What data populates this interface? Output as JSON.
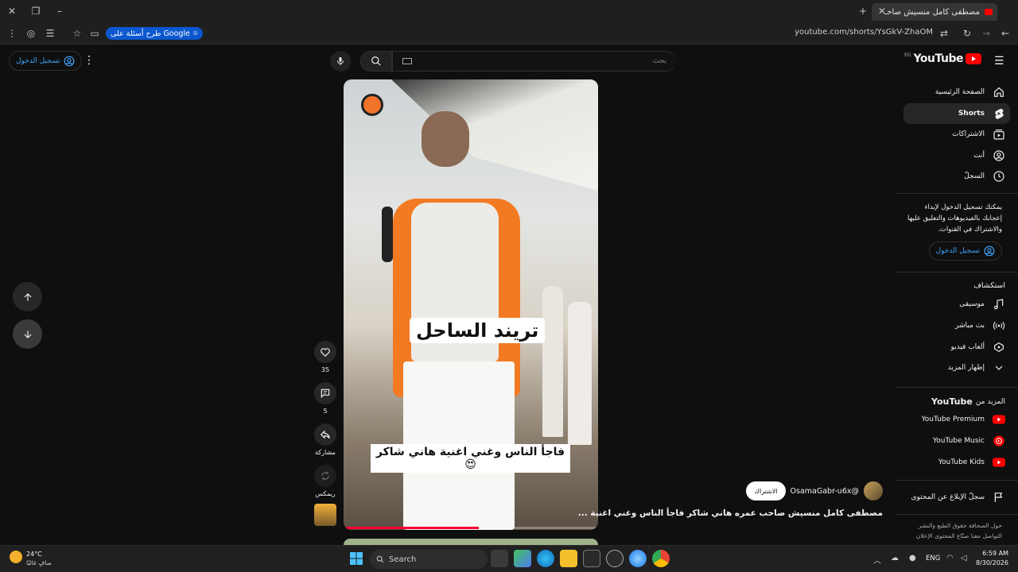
{
  "browser": {
    "tab_title": "مصطفى كامل منسيش صاحـ",
    "url": "youtube.com/shorts/YsGkV-ZhaOM",
    "google_pill": "طرح أسئلة على Google"
  },
  "youtube": {
    "logo_text": "YouTube",
    "logo_region": "EG",
    "search_placeholder": "بحث",
    "signin_label": "تسجيل الدخول"
  },
  "sidebar": {
    "items": [
      {
        "label": "الصفحة الرئيسية",
        "icon": "home-icon"
      },
      {
        "label": "Shorts",
        "icon": "shorts-icon",
        "active": true
      },
      {
        "label": "الاشتراكات",
        "icon": "subscriptions-icon"
      },
      {
        "label": "أنت",
        "icon": "you-icon"
      },
      {
        "label": "السجلّ",
        "icon": "history-icon"
      }
    ],
    "signin_prompt": "يمكنك تسجيل الدخول لإبداء إعجابك بالفيديوهات والتعليق عليها والاشتراك في القنوات.",
    "signin_label": "تسجيل الدخول",
    "explore_heading": "استكشاف",
    "explore_items": [
      {
        "label": "موسيقى",
        "icon": "music-icon"
      },
      {
        "label": "بث مباشر",
        "icon": "live-icon"
      },
      {
        "label": "ألعاب فيديو",
        "icon": "gaming-icon"
      },
      {
        "label": "إظهار المزيد",
        "icon": "chevron-down-icon"
      }
    ],
    "more_heading_prefix": "المزيد من",
    "more_heading_brand": "YouTube",
    "more_items": [
      {
        "label": "YouTube Premium",
        "icon": "premium-icon"
      },
      {
        "label": "YouTube Music",
        "icon": "yt-music-icon"
      },
      {
        "label": "YouTube Kids",
        "icon": "yt-kids-icon"
      }
    ],
    "report_label": "سجلّ الإبلاغ عن المحتوى",
    "footer_line1": "حول  الصحافة  حقوق الطبع والنشر",
    "footer_line2": "التواصل معنا  صنّاع المحتوى  الإعلان"
  },
  "short": {
    "caption_big": "تريند الساحل",
    "caption_small": "فاجأ الناس وغني اغنية هاني شاكر😍",
    "likes": "35",
    "comments": "5",
    "share_label": "مشاركة",
    "remix_label": "ريمكس",
    "channel": "@OsamaGabr-u6x",
    "subscribe_label": "الاشتراك",
    "title": "مصطفى كامل منسيش صاحب عمره هاني شاكر فاجأ الناس وغني اغنية ..."
  },
  "taskbar": {
    "temperature": "24°C",
    "weather": "صافٍ غالبًا",
    "search_label": "Search",
    "language": "ENG",
    "time": "6:59 AM",
    "date": "8/30/2026"
  },
  "colors": {
    "accent": "#3ea6ff",
    "brand_red": "#ff0000",
    "background": "#0f0f0f"
  }
}
